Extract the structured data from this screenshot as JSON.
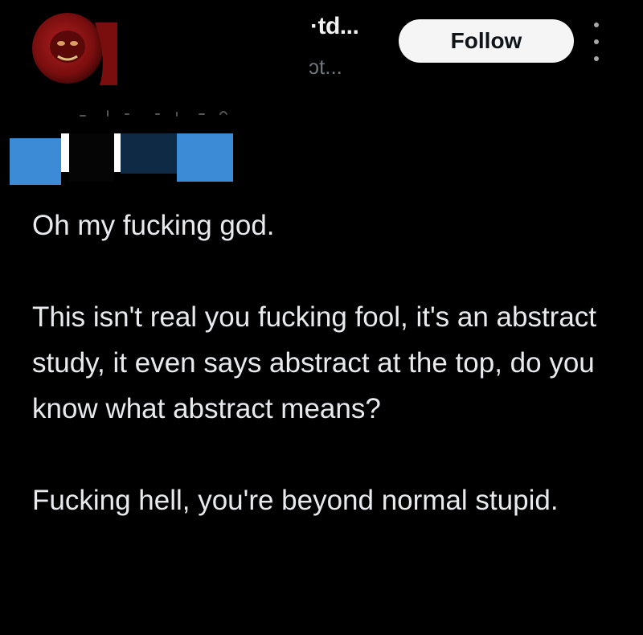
{
  "profile": {
    "display_name": "·td...",
    "handle": "ɔt...",
    "avatar_icon": "red-gorilla-avatar-icon"
  },
  "header": {
    "follow_label": "Follow",
    "more_icon": "vertical-ellipsis-icon"
  },
  "colors": {
    "background": "#000000",
    "text": "#e8eaed",
    "muted": "#6e767d",
    "follow_bg": "#f5f5f5",
    "redaction_blue": "#3b8bd6",
    "avatar_red": "#8c1515"
  },
  "tweet": {
    "paragraphs": [
      "Oh my fucking god.",
      "This isn't real you fucking fool, it's an abstract study, it even says abstract at the top, do you know what abstract means?",
      "Fucking hell, you're beyond normal stupid."
    ]
  }
}
